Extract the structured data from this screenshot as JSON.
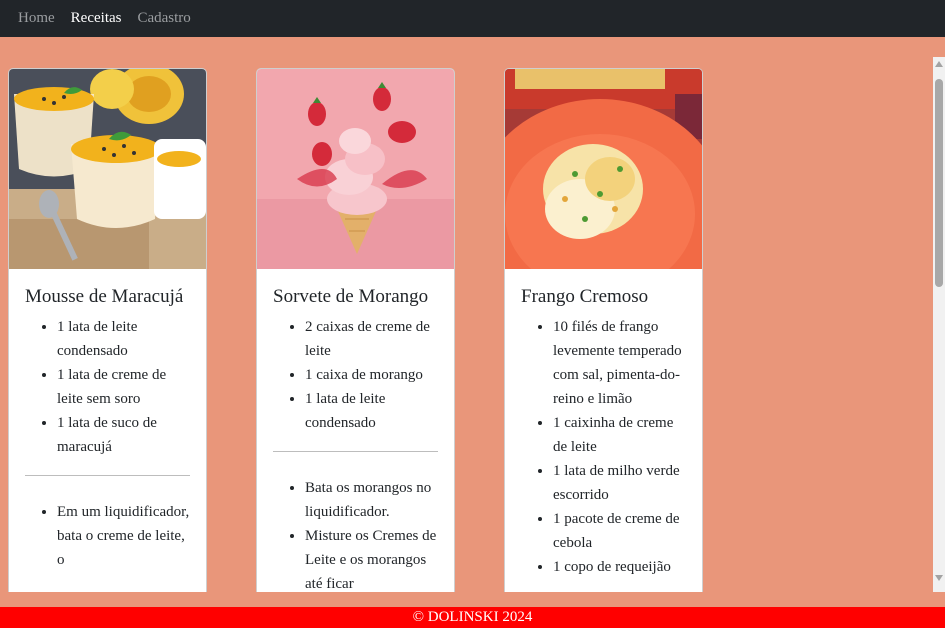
{
  "nav": {
    "links": [
      {
        "label": "Home"
      },
      {
        "label": "Receitas"
      },
      {
        "label": "Cadastro"
      }
    ]
  },
  "cards": [
    {
      "title": "Mousse de Maracujá",
      "ingredients": [
        "1 lata de leite condensado",
        "1 lata de creme de leite sem soro",
        "1 lata de suco de maracujá"
      ],
      "steps": [
        "Em um liquidificador, bata o creme de leite, o"
      ]
    },
    {
      "title": "Sorvete de Morango",
      "ingredients": [
        "2 caixas de creme de leite",
        "1 caixa de morango",
        "1 lata de leite condensado"
      ],
      "steps": [
        "Bata os morangos no liquidificador.",
        "Misture os Cremes de Leite e os morangos até ficar"
      ]
    },
    {
      "title": "Frango Cremoso",
      "ingredients": [
        "10 filés de frango levemente temperado com sal, pimenta-do-reino e limão",
        "1 caixinha de creme de leite",
        "1 lata de milho verde escorrido",
        "1 pacote de creme de cebola",
        "1 copo de requeijão"
      ],
      "steps": []
    }
  ],
  "footer": {
    "text": "© DOLINSKI 2024"
  },
  "colors": {
    "background": "#e9967a",
    "navbar": "#212529",
    "footer": "#ff0000"
  }
}
